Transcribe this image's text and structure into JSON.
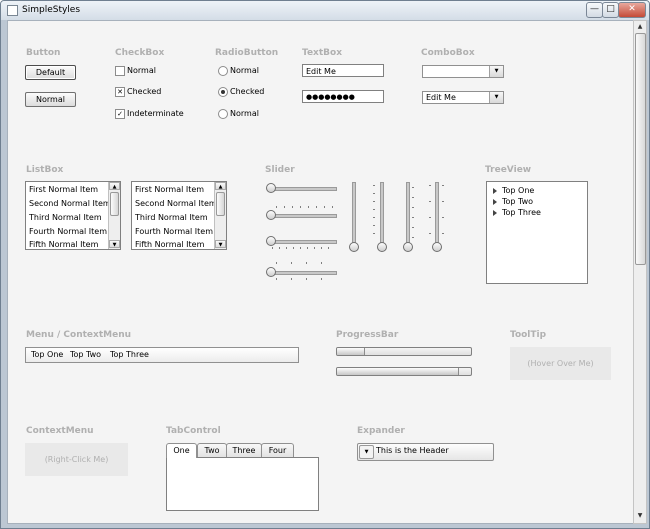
{
  "window": {
    "title": "SimpleStyles",
    "controls": {
      "minimize": "—",
      "maximize": "□",
      "close": "✕"
    }
  },
  "sections": {
    "button": "Button",
    "checkbox": "CheckBox",
    "radiobutton": "RadioButton",
    "textbox": "TextBox",
    "combobox": "ComboBox",
    "listbox": "ListBox",
    "slider": "Slider",
    "treeview": "TreeView",
    "menu": "Menu / ContextMenu",
    "progressbar": "ProgressBar",
    "tooltip": "ToolTip",
    "contextmenu": "ContextMenu",
    "tabcontrol": "TabControl",
    "expander": "Expander"
  },
  "buttons": {
    "default_label": "Default",
    "normal_label": "Normal"
  },
  "checkboxes": [
    {
      "label": "Normal",
      "mark": ""
    },
    {
      "label": "Checked",
      "mark": "✕"
    },
    {
      "label": "Indeterminate",
      "mark": "✓"
    }
  ],
  "radios": [
    {
      "label": "Normal",
      "checked": false
    },
    {
      "label": "Checked",
      "checked": true
    },
    {
      "label": "Normal",
      "checked": false
    }
  ],
  "textboxes": {
    "first_value": "Edit Me",
    "password_value": "●●●●●●●●"
  },
  "comboboxes": {
    "first_value": "",
    "second_value": "Edit Me",
    "arrow": "▼"
  },
  "listbox": {
    "items": [
      "First Normal Item",
      "Second Normal Item",
      "Third Normal Item",
      "Fourth Normal Item",
      "Fifth Normal Item"
    ],
    "up_arrow": "▲",
    "down_arrow": "▼"
  },
  "treeview": {
    "nodes": [
      "Top One",
      "Top Two",
      "Top Three"
    ]
  },
  "menu": {
    "items": [
      "Top One",
      "Top Two",
      "Top Three"
    ]
  },
  "progress": [
    {
      "value": 0.2
    },
    {
      "value": 0.9
    }
  ],
  "tooltip": {
    "text": "(Hover Over Me)"
  },
  "contextmenu": {
    "text": "(Right-Click Me)"
  },
  "tabs": [
    "One",
    "Two",
    "Three",
    "Four"
  ],
  "expander": {
    "header": "This is the Header",
    "toggle": "▼"
  },
  "scrollbar": {
    "up": "▲",
    "down": "▼"
  }
}
